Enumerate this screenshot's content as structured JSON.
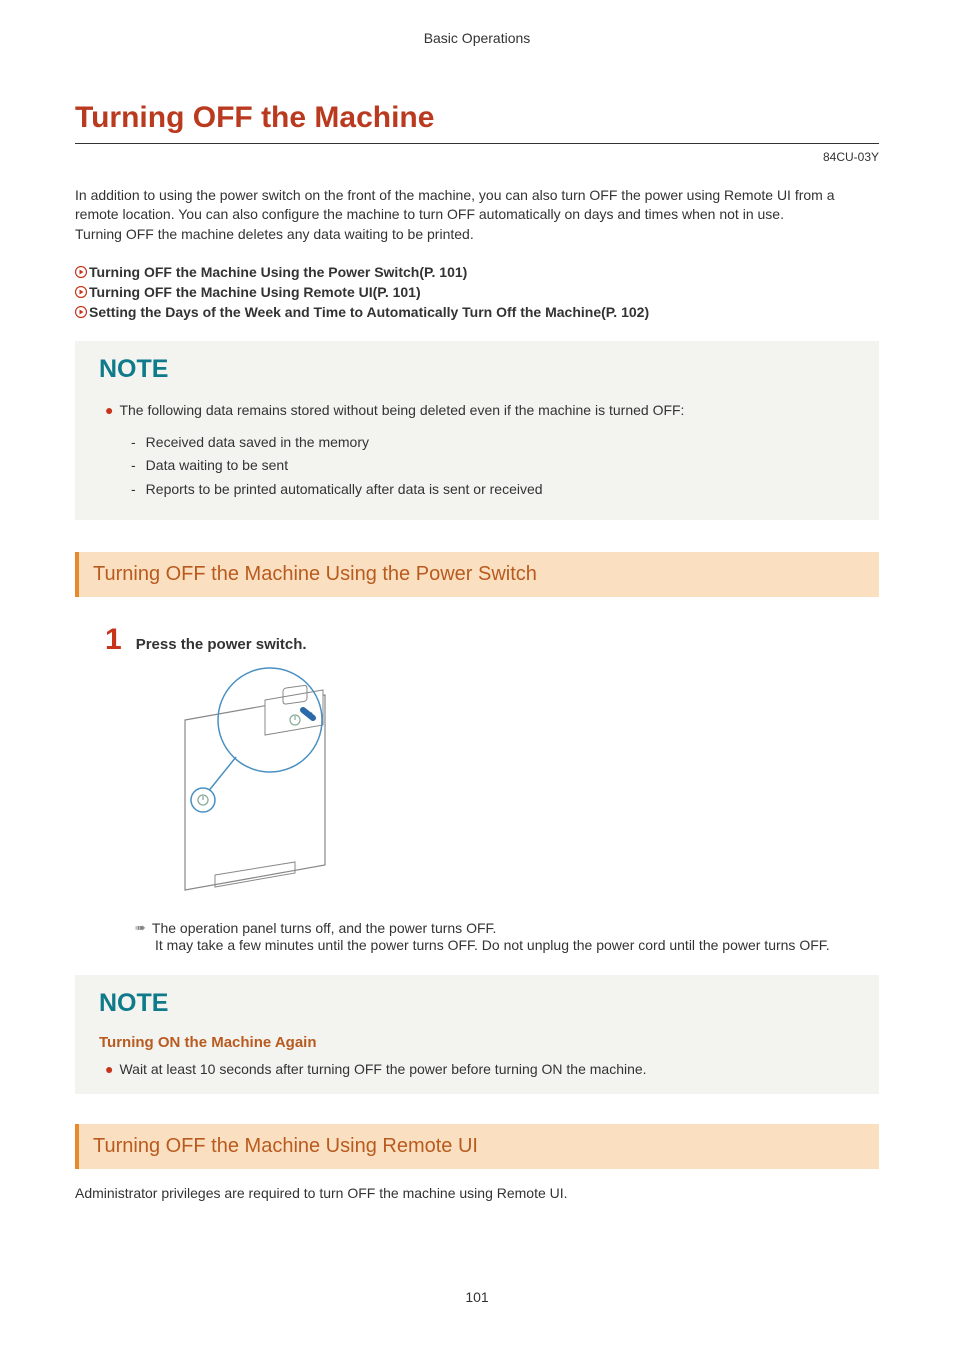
{
  "header": {
    "section": "Basic Operations"
  },
  "title": "Turning OFF the Machine",
  "doc_code": "84CU-03Y",
  "intro": [
    "In addition to using the power switch on the front of the machine, you can also turn OFF the power using Remote UI from a remote location. You can also configure the machine to turn OFF automatically on days and times when not in use.",
    "Turning OFF the machine deletes any data waiting to be printed."
  ],
  "toc": [
    "Turning OFF the Machine Using the Power Switch(P. 101)",
    "Turning OFF the Machine Using Remote UI(P. 101)",
    "Setting the Days of the Week and Time to Automatically Turn Off the Machine(P. 102)"
  ],
  "note1": {
    "title": "NOTE",
    "lead": "The following data remains stored without being deleted even if the machine is turned OFF:",
    "items": [
      "Received data saved in the memory",
      "Data waiting to be sent",
      "Reports to be printed automatically after data is sent or received"
    ]
  },
  "section1": {
    "title": "Turning OFF the Machine Using the Power Switch",
    "step_num": "1",
    "step_text": "Press the power switch.",
    "result1": "The operation panel turns off, and the power turns OFF.",
    "result2": "It may take a few minutes until the power turns OFF. Do not unplug the power cord until the power turns OFF."
  },
  "note2": {
    "title": "NOTE",
    "subtitle": "Turning ON the Machine Again",
    "text": "Wait at least 10 seconds after turning OFF the power before turning ON the machine."
  },
  "section2": {
    "title": "Turning OFF the Machine Using Remote UI",
    "body": "Administrator privileges are required to turn OFF the machine using Remote UI."
  },
  "page_number": "101"
}
